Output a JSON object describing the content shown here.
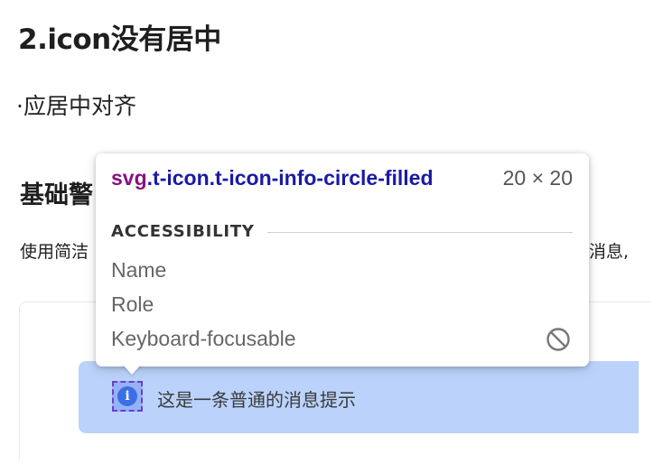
{
  "doc": {
    "heading": "2.icon没有居中",
    "paragraph": "·应居中对齐",
    "section_title": "基础警",
    "description": "使用简洁",
    "description_tail": "消息,"
  },
  "alert": {
    "text": "这是一条普通的消息提示",
    "icon": "info-circle-filled-icon",
    "icon_glyph": "i",
    "background": "#bbd3fb",
    "icon_color": "#3b6fe6"
  },
  "inspector_tooltip": {
    "selector_tag": "svg",
    "selector_classes": ".t-icon.t-icon-info-circle-filled",
    "size": "20 × 20",
    "section_title": "ACCESSIBILITY",
    "rows": [
      {
        "label": "Name"
      },
      {
        "label": "Role"
      },
      {
        "label": "Keyboard-focusable",
        "status_icon": "not-allowed-icon"
      }
    ],
    "tag_color": "#881280",
    "class_color": "#1a1aa6"
  }
}
